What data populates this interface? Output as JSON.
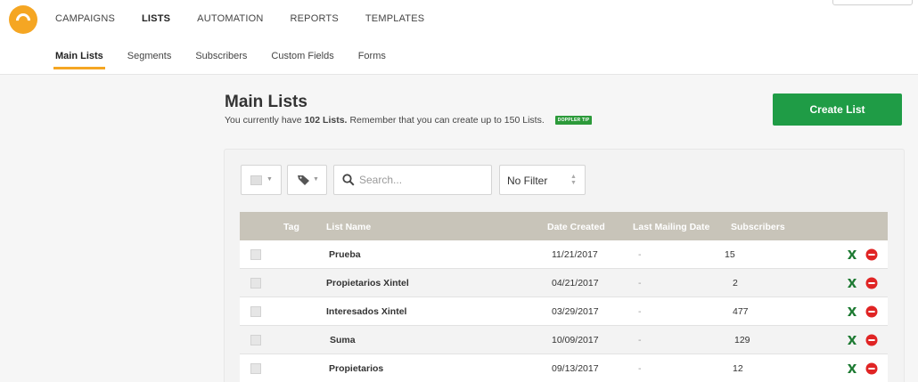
{
  "nav": {
    "main": [
      "CAMPAIGNS",
      "LISTS",
      "AUTOMATION",
      "REPORTS",
      "TEMPLATES"
    ],
    "main_active": "LISTS",
    "sub": [
      "Main Lists",
      "Segments",
      "Subscribers",
      "Custom Fields",
      "Forms"
    ],
    "sub_active": "Main Lists"
  },
  "header": {
    "title": "Main Lists",
    "subtitle_pre": "You currently have",
    "subtitle_count": "102 Lists.",
    "subtitle_post": "Remember that you can create up to 150 Lists.",
    "tip_badge": "DOPPLER TIP",
    "create_button": "Create List"
  },
  "toolbar": {
    "search_placeholder": "Search...",
    "filter_value": "No Filter"
  },
  "table": {
    "headers": {
      "tag": "Tag",
      "name": "List Name",
      "date_created": "Date Created",
      "last_mailing": "Last Mailing Date",
      "subscribers": "Subscribers"
    },
    "rows": [
      {
        "name": "Prueba",
        "date_created": "11/21/2017",
        "last_mailing": "-",
        "subscribers": "15"
      },
      {
        "name": "Propietarios Xintel",
        "date_created": "04/21/2017",
        "last_mailing": "-",
        "subscribers": "2"
      },
      {
        "name": "Interesados Xintel",
        "date_created": "03/29/2017",
        "last_mailing": "-",
        "subscribers": "477"
      },
      {
        "name": "Suma",
        "date_created": "10/09/2017",
        "last_mailing": "-",
        "subscribers": "129"
      },
      {
        "name": "Propietarios",
        "date_created": "09/13/2017",
        "last_mailing": "-",
        "subscribers": "12"
      }
    ]
  },
  "colors": {
    "brand_orange": "#f5a623",
    "create_green": "#1f9c46",
    "header_row": "#c8c4b9",
    "delete_red": "#e02424",
    "excel_green": "#1d7a32"
  }
}
